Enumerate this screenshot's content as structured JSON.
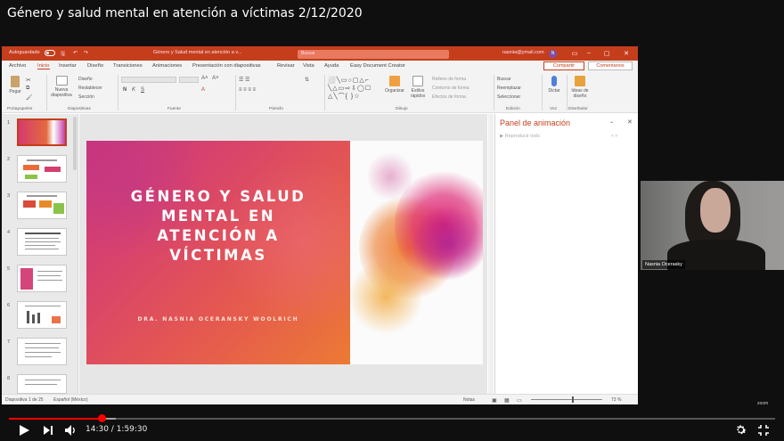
{
  "video": {
    "title": "Género y salud mental en atención a víctimas 2/12/2020",
    "current_time": "14:30",
    "duration": "1:59:30",
    "time_display": "14:30 / 1:59:30",
    "progress": 0.121,
    "buffered": 0.14
  },
  "ppt": {
    "autosave_label": "Autoguardado",
    "doc_title": "Género y Salud mental  en atención a v...",
    "search_placeholder": "Buscar",
    "account": "nasnia@ymail.com",
    "avatar_initial": "N",
    "tabs": [
      "Archivo",
      "Inicio",
      "Insertar",
      "Diseño",
      "Transiciones",
      "Animaciones",
      "Presentación con diapositivas",
      "Revisar",
      "Vista",
      "Ayuda",
      "Easy Document Creator"
    ],
    "active_tab": "Inicio",
    "share_label": "Compartir",
    "comments_label": "Comentarios",
    "ribbon": {
      "paste": "Pegar",
      "new_slide": "Nueva diapositiva",
      "layout": "Diseño",
      "reset": "Restablecer",
      "section": "Sección",
      "arrange": "Organizar",
      "quick_styles": "Estilos rápidos",
      "shape_fill": "Relleno de forma",
      "shape_outline": "Contorno de forma",
      "shape_effects": "Efectos de forma",
      "find": "Buscar",
      "replace": "Reemplazar",
      "select": "Seleccionar",
      "dictate": "Dictar",
      "design_ideas": "Ideas de diseño",
      "groups": {
        "clipboard": "Portapapeles",
        "slides": "Diapositivas",
        "font": "Fuente",
        "paragraph": "Párrafo",
        "drawing": "Dibujo",
        "editing": "Edición",
        "voice": "Voz",
        "designer": "Diseñador"
      }
    },
    "slide_numbers": [
      "1",
      "2",
      "3",
      "4",
      "5",
      "6",
      "7",
      "8"
    ],
    "slide": {
      "title": "GÉNERO Y SALUD MENTAL  EN ATENCIÓN A VÍCTIMAS",
      "title_lines": [
        "GÉNERO Y SALUD",
        "MENTAL  EN",
        "ATENCIÓN A",
        "VÍCTIMAS"
      ],
      "author": "DRA. NASNIA OCERANSKY WOOLRICH"
    },
    "animation_pane": {
      "title": "Panel de animación",
      "play_label": "Reproducir todo"
    },
    "status": {
      "slide_count": "Diapositiva 1 de 25",
      "language": "Español (México)",
      "notes": "Notas",
      "zoom": "73 %"
    }
  },
  "webcam": {
    "participant_name": "Nasnia Ocerasky"
  },
  "colors": {
    "ppt_accent": "#c43e1c",
    "yt_red": "#ff0000",
    "slide_gradient_start": "#c8357e",
    "slide_gradient_end": "#ec7a35"
  },
  "icons": [
    "play-icon",
    "next-icon",
    "volume-icon",
    "settings-gear-icon",
    "exit-fullscreen-icon"
  ]
}
